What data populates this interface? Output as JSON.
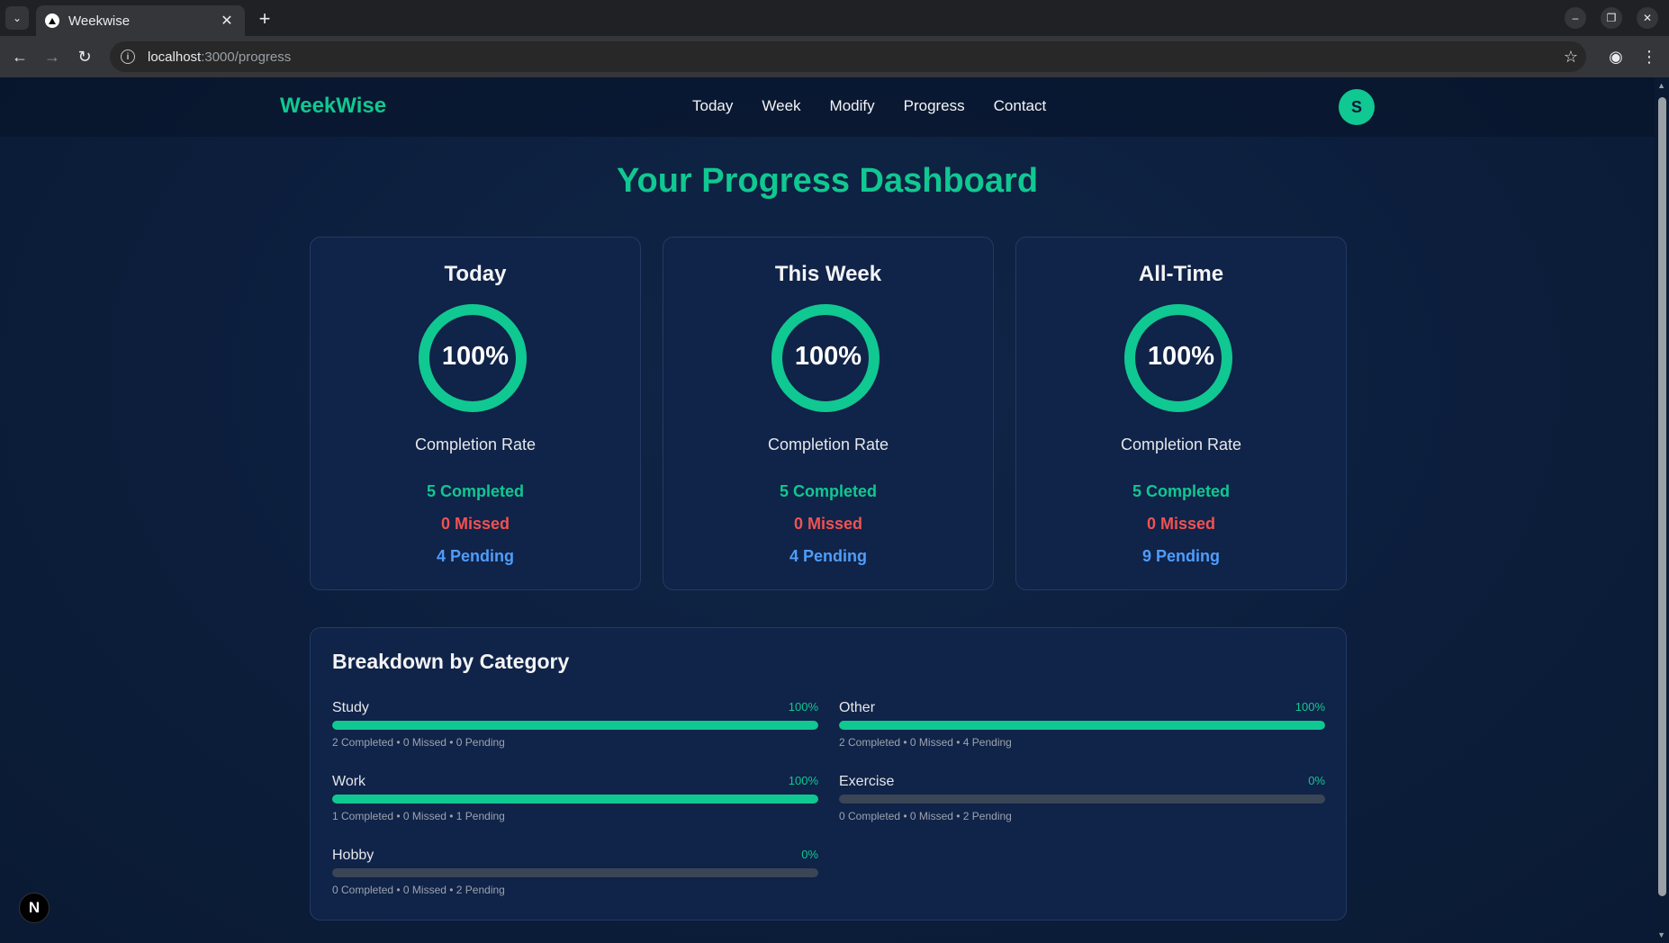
{
  "browser": {
    "tab_title": "Weekwise",
    "url_host": "localhost",
    "url_path": ":3000/progress",
    "new_tab_glyph": "+",
    "close_glyph": "✕"
  },
  "site": {
    "brand": "WeekWise",
    "nav": [
      "Today",
      "Week",
      "Modify",
      "Progress",
      "Contact"
    ],
    "avatar_initial": "S"
  },
  "page_title": "Your Progress Dashboard",
  "cards": [
    {
      "title": "Today",
      "rate_percent": 100,
      "rate_text": "100%",
      "label": "Completion Rate",
      "completed": "5 Completed",
      "missed": "0 Missed",
      "pending": "4 Pending"
    },
    {
      "title": "This Week",
      "rate_percent": 100,
      "rate_text": "100%",
      "label": "Completion Rate",
      "completed": "5 Completed",
      "missed": "0 Missed",
      "pending": "4 Pending"
    },
    {
      "title": "All-Time",
      "rate_percent": 100,
      "rate_text": "100%",
      "label": "Completion Rate",
      "completed": "5 Completed",
      "missed": "0 Missed",
      "pending": "9 Pending"
    }
  ],
  "breakdown": {
    "title": "Breakdown by Category",
    "categories": [
      {
        "name": "Study",
        "percent_text": "100%",
        "percent": 100,
        "detail": "2 Completed • 0 Missed • 0 Pending"
      },
      {
        "name": "Other",
        "percent_text": "100%",
        "percent": 100,
        "detail": "2 Completed • 0 Missed • 4 Pending"
      },
      {
        "name": "Work",
        "percent_text": "100%",
        "percent": 100,
        "detail": "1 Completed • 0 Missed • 1 Pending"
      },
      {
        "name": "Exercise",
        "percent_text": "0%",
        "percent": 0,
        "detail": "0 Completed • 0 Missed • 2 Pending"
      },
      {
        "name": "Hobby",
        "percent_text": "0%",
        "percent": 0,
        "detail": "0 Completed • 0 Missed • 2 Pending"
      }
    ]
  },
  "dev_badge": "N",
  "colors": {
    "accent": "#10c891",
    "missed": "#f05252",
    "pending": "#4f9dfa",
    "card_bg": "#102348",
    "page_bg": "#0b1a33"
  }
}
